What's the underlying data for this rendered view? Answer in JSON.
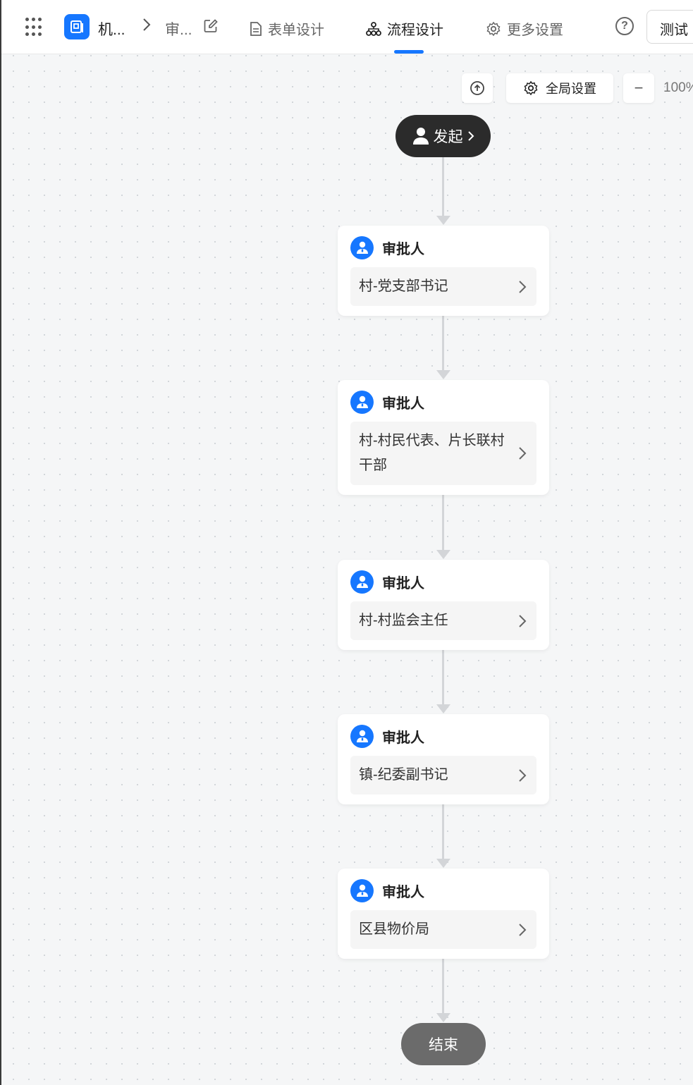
{
  "header": {
    "app_name": "机...",
    "form_name": "审...",
    "tabs": [
      {
        "label": "表单设计",
        "active": false
      },
      {
        "label": "流程设计",
        "active": true
      },
      {
        "label": "更多设置",
        "active": false
      }
    ],
    "help_label": "?",
    "test_button": "测试"
  },
  "toolbar": {
    "global_settings": "全局设置",
    "zoom_out": "−",
    "zoom_level": "100%"
  },
  "flow": {
    "start_label": "发起",
    "end_label": "结束",
    "nodes": [
      {
        "title": "审批人",
        "assignee": "村-党支部书记"
      },
      {
        "title": "审批人",
        "assignee": "村-村民代表、片长联村干部"
      },
      {
        "title": "审批人",
        "assignee": "村-村监会主任"
      },
      {
        "title": "审批人",
        "assignee": "镇-纪委副书记"
      },
      {
        "title": "审批人",
        "assignee": "区县物价局"
      }
    ]
  },
  "colors": {
    "accent": "#1677ff",
    "start_node": "#2b2b2b",
    "end_node": "#6b6b6b",
    "edge": "#d3d5d8"
  }
}
